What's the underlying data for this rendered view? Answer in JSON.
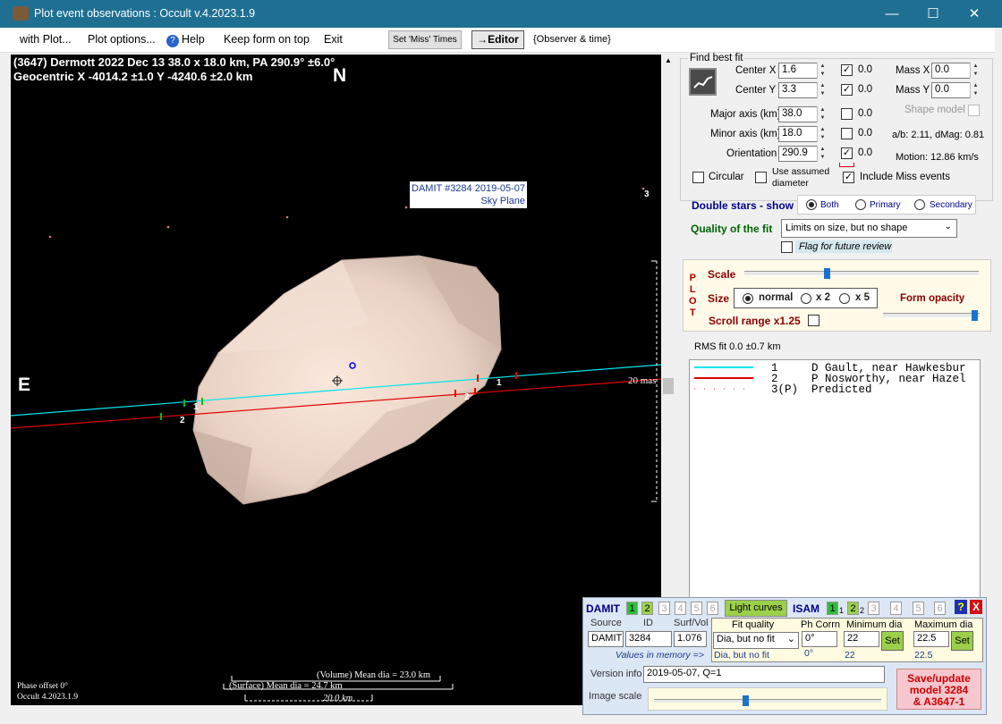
{
  "window": {
    "title": "Plot event observations : Occult v.4.2023.1.9",
    "minimize": "—",
    "maximize": "☐",
    "close": "✕"
  },
  "menu": {
    "with_plot": "with Plot...",
    "plot_options": "Plot options...",
    "help": "Help",
    "keep_on_top": "Keep form on top",
    "exit": "Exit",
    "set_miss": "Set 'Miss' Times",
    "editor": "→Editor",
    "observer_time": "{Observer & time}"
  },
  "plot": {
    "header1": "(3647) Dermott  2022 Dec 13  38.0 x 18.0 km, PA 290.9° ±6.0°",
    "header2": "Geocentric  X  -4014.2 ±1.0  Y -4240.6 ±2.0 km",
    "north": "N",
    "east": "E",
    "damit_label1": "DAMIT #3284 2019-05-07",
    "damit_label2": "Sky Plane",
    "chord1_a": "1",
    "chord2_a": "2",
    "chord1_b": "1",
    "chord2_b": "2",
    "point3": "3",
    "scale_text": "20 mas",
    "phase_offset": "Phase offset 0°",
    "version": "Occult 4.2023.1.9",
    "vol_dia": "(Volume) Mean dia = 23.0 km",
    "surf_dia": "(Surface) Mean dia = 24.7 km",
    "scale_km": "20.0 km"
  },
  "fit": {
    "group_title": "Find best fit",
    "center_x_label": "Center X",
    "center_x": "1.6",
    "center_y_label": "Center Y",
    "center_y": "3.3",
    "major_label": "Major axis (km)",
    "major": "38.0",
    "minor_label": "Minor axis (km)",
    "minor": "18.0",
    "orient_label": "Orientation",
    "orient": "290.9",
    "cx_step": "0.0",
    "cy_step": "0.0",
    "major_step": "0.0",
    "minor_step": "0.0",
    "orient_step": "0.0",
    "mass_x_label": "Mass X",
    "mass_x": "0.0",
    "mass_y_label": "Mass Y",
    "mass_y": "0.0",
    "shape_model": "Shape model",
    "ab_text": "a/b: 2.11, dMag: 0.81",
    "motion": "Motion: 12.86 km/s",
    "circular": "Circular",
    "use_assumed": "Use assumed",
    "diameter": "diameter",
    "include_miss": "Include Miss events"
  },
  "double": {
    "label": "Double stars - show",
    "both": "Both",
    "primary": "Primary",
    "secondary": "Secondary"
  },
  "quality": {
    "label": "Quality of the fit",
    "value": "Limits on size, but no shape",
    "flag": "Flag for future review"
  },
  "plotpanel": {
    "side": [
      "P",
      "L",
      "O",
      "T"
    ],
    "scale": "Scale",
    "size": "Size",
    "normal": "normal",
    "x2": "x 2",
    "x5": "x 5",
    "form_opacity": "Form opacity",
    "scroll_range": "Scroll range x1.25",
    "scale_value": 0.35,
    "opacity_value": 0.98
  },
  "rms": "RMS fit 0.0 ±0.7 km",
  "legend": [
    {
      "num": "1",
      "name": "D Gault, near Hawkesbur",
      "color": "#00e5ee"
    },
    {
      "num": "2",
      "name": "P Nosworthy, near Hazel",
      "color": "#e00000"
    },
    {
      "num": "3(P)",
      "name": "Predicted",
      "color": "#e08080"
    }
  ],
  "damit": {
    "title": "DAMIT",
    "nums": [
      "1",
      "2",
      "3",
      "4",
      "5",
      "6"
    ],
    "light_curves": "Light curves",
    "isam": "ISAM",
    "isam_nums": [
      "1",
      "1",
      "2",
      "2",
      "3",
      "4",
      "5",
      "6"
    ],
    "help": "?",
    "close": "X",
    "source_label": "Source",
    "id_label": "ID",
    "surfvol_label": "Surf/Vol",
    "fit_quality_label": "Fit quality",
    "ph_corrn_label": "Ph Corrn",
    "min_dia_label": "Minimum dia",
    "max_dia_label": "Maximum dia",
    "source": "DAMIT",
    "id": "3284",
    "surfvol": "1.076",
    "fit_quality": "Dia, but no fit",
    "ph_corrn": "0°",
    "min_dia": "22",
    "max_dia": "22.5",
    "set": "Set",
    "values_mem": "Values in memory =>",
    "mem_fit": "Dia, but no fit",
    "mem_ph": "0°",
    "mem_min": "22",
    "mem_max": "22.5",
    "version_label": "Version info",
    "version": "2019-05-07, Q=1",
    "image_scale": "Image scale",
    "save1": "Save/update",
    "save2": "model 3284",
    "save3": "& A3647-1",
    "image_scale_value": 0.4
  }
}
